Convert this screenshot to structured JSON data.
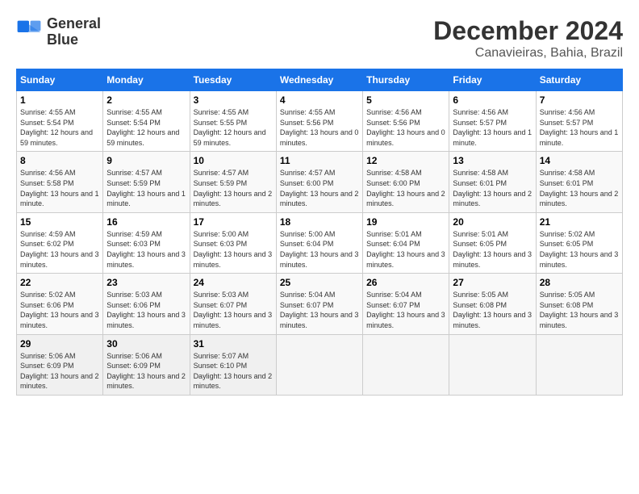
{
  "logo": {
    "line1": "General",
    "line2": "Blue"
  },
  "title": "December 2024",
  "location": "Canavieiras, Bahia, Brazil",
  "days_of_week": [
    "Sunday",
    "Monday",
    "Tuesday",
    "Wednesday",
    "Thursday",
    "Friday",
    "Saturday"
  ],
  "weeks": [
    [
      {
        "day": "1",
        "sunrise": "4:55 AM",
        "sunset": "5:54 PM",
        "daylight": "12 hours and 59 minutes."
      },
      {
        "day": "2",
        "sunrise": "4:55 AM",
        "sunset": "5:54 PM",
        "daylight": "12 hours and 59 minutes."
      },
      {
        "day": "3",
        "sunrise": "4:55 AM",
        "sunset": "5:55 PM",
        "daylight": "12 hours and 59 minutes."
      },
      {
        "day": "4",
        "sunrise": "4:55 AM",
        "sunset": "5:56 PM",
        "daylight": "13 hours and 0 minutes."
      },
      {
        "day": "5",
        "sunrise": "4:56 AM",
        "sunset": "5:56 PM",
        "daylight": "13 hours and 0 minutes."
      },
      {
        "day": "6",
        "sunrise": "4:56 AM",
        "sunset": "5:57 PM",
        "daylight": "13 hours and 1 minute."
      },
      {
        "day": "7",
        "sunrise": "4:56 AM",
        "sunset": "5:57 PM",
        "daylight": "13 hours and 1 minute."
      }
    ],
    [
      {
        "day": "8",
        "sunrise": "4:56 AM",
        "sunset": "5:58 PM",
        "daylight": "13 hours and 1 minute."
      },
      {
        "day": "9",
        "sunrise": "4:57 AM",
        "sunset": "5:59 PM",
        "daylight": "13 hours and 1 minute."
      },
      {
        "day": "10",
        "sunrise": "4:57 AM",
        "sunset": "5:59 PM",
        "daylight": "13 hours and 2 minutes."
      },
      {
        "day": "11",
        "sunrise": "4:57 AM",
        "sunset": "6:00 PM",
        "daylight": "13 hours and 2 minutes."
      },
      {
        "day": "12",
        "sunrise": "4:58 AM",
        "sunset": "6:00 PM",
        "daylight": "13 hours and 2 minutes."
      },
      {
        "day": "13",
        "sunrise": "4:58 AM",
        "sunset": "6:01 PM",
        "daylight": "13 hours and 2 minutes."
      },
      {
        "day": "14",
        "sunrise": "4:58 AM",
        "sunset": "6:01 PM",
        "daylight": "13 hours and 2 minutes."
      }
    ],
    [
      {
        "day": "15",
        "sunrise": "4:59 AM",
        "sunset": "6:02 PM",
        "daylight": "13 hours and 3 minutes."
      },
      {
        "day": "16",
        "sunrise": "4:59 AM",
        "sunset": "6:03 PM",
        "daylight": "13 hours and 3 minutes."
      },
      {
        "day": "17",
        "sunrise": "5:00 AM",
        "sunset": "6:03 PM",
        "daylight": "13 hours and 3 minutes."
      },
      {
        "day": "18",
        "sunrise": "5:00 AM",
        "sunset": "6:04 PM",
        "daylight": "13 hours and 3 minutes."
      },
      {
        "day": "19",
        "sunrise": "5:01 AM",
        "sunset": "6:04 PM",
        "daylight": "13 hours and 3 minutes."
      },
      {
        "day": "20",
        "sunrise": "5:01 AM",
        "sunset": "6:05 PM",
        "daylight": "13 hours and 3 minutes."
      },
      {
        "day": "21",
        "sunrise": "5:02 AM",
        "sunset": "6:05 PM",
        "daylight": "13 hours and 3 minutes."
      }
    ],
    [
      {
        "day": "22",
        "sunrise": "5:02 AM",
        "sunset": "6:06 PM",
        "daylight": "13 hours and 3 minutes."
      },
      {
        "day": "23",
        "sunrise": "5:03 AM",
        "sunset": "6:06 PM",
        "daylight": "13 hours and 3 minutes."
      },
      {
        "day": "24",
        "sunrise": "5:03 AM",
        "sunset": "6:07 PM",
        "daylight": "13 hours and 3 minutes."
      },
      {
        "day": "25",
        "sunrise": "5:04 AM",
        "sunset": "6:07 PM",
        "daylight": "13 hours and 3 minutes."
      },
      {
        "day": "26",
        "sunrise": "5:04 AM",
        "sunset": "6:07 PM",
        "daylight": "13 hours and 3 minutes."
      },
      {
        "day": "27",
        "sunrise": "5:05 AM",
        "sunset": "6:08 PM",
        "daylight": "13 hours and 3 minutes."
      },
      {
        "day": "28",
        "sunrise": "5:05 AM",
        "sunset": "6:08 PM",
        "daylight": "13 hours and 3 minutes."
      }
    ],
    [
      {
        "day": "29",
        "sunrise": "5:06 AM",
        "sunset": "6:09 PM",
        "daylight": "13 hours and 2 minutes."
      },
      {
        "day": "30",
        "sunrise": "5:06 AM",
        "sunset": "6:09 PM",
        "daylight": "13 hours and 2 minutes."
      },
      {
        "day": "31",
        "sunrise": "5:07 AM",
        "sunset": "6:10 PM",
        "daylight": "13 hours and 2 minutes."
      },
      null,
      null,
      null,
      null
    ]
  ]
}
